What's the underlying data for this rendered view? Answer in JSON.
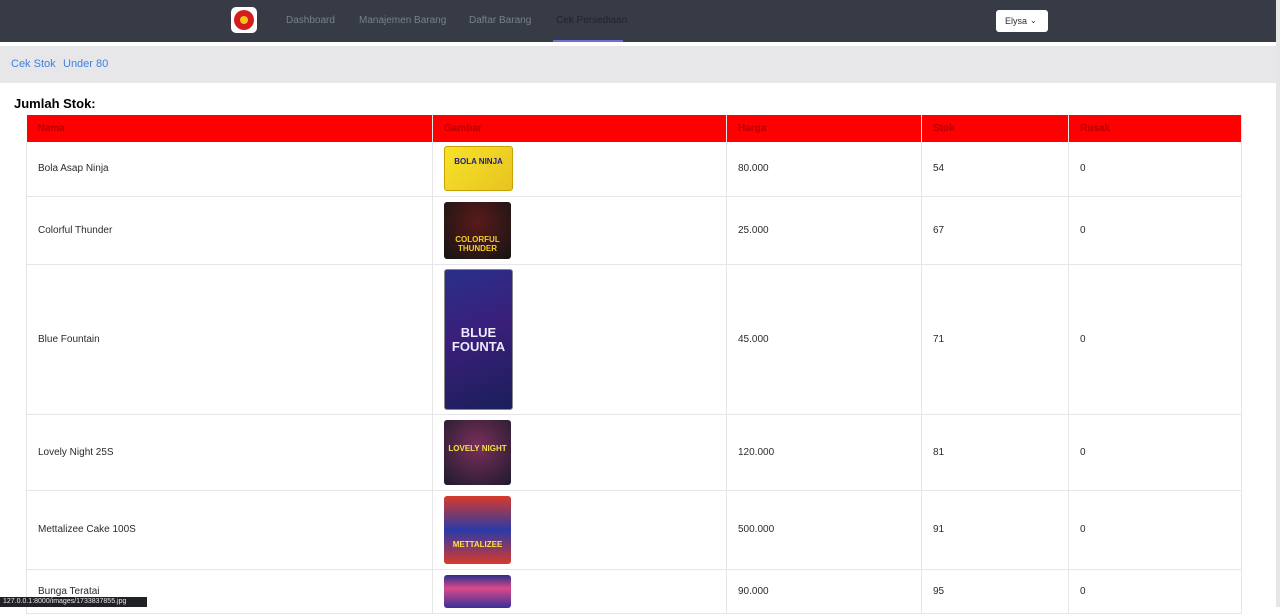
{
  "nav": {
    "logo": "firework-logo",
    "items": [
      {
        "label": "Dashboard"
      },
      {
        "label": "Manajemen Barang"
      },
      {
        "label": "Daftar Barang"
      },
      {
        "label": "Cek Persediaan",
        "active": true
      }
    ],
    "user": {
      "name": "Elysa",
      "icon": "chevron-down-icon"
    }
  },
  "subnav": {
    "items": [
      {
        "label": "Cek Stok"
      },
      {
        "label": "Under 80"
      }
    ]
  },
  "heading": "Jumlah Stok:",
  "table": {
    "headers": [
      "Nama",
      "Gambar",
      "Harga",
      "Stok",
      "Rusak"
    ],
    "rows": [
      {
        "nama": "Bola Asap Ninja",
        "gambar_text": "BOLA NINJA",
        "harga": "80.000",
        "stok": "54",
        "rusak": "0"
      },
      {
        "nama": "Colorful Thunder",
        "gambar_text": "COLORFUL THUNDER",
        "harga": "25.000",
        "stok": "67",
        "rusak": "0"
      },
      {
        "nama": "Blue Fountain",
        "gambar_text": "BLUE FOUNTA",
        "harga": "45.000",
        "stok": "71",
        "rusak": "0"
      },
      {
        "nama": "Lovely Night 25S",
        "gambar_text": "LOVELY NIGHT",
        "harga": "120.000",
        "stok": "81",
        "rusak": "0"
      },
      {
        "nama": "Mettalizee Cake 100S",
        "gambar_text": "METTALIZEE",
        "harga": "500.000",
        "stok": "91",
        "rusak": "0"
      },
      {
        "nama": "Bunga Teratai",
        "gambar_text": "",
        "harga": "90.000",
        "stok": "95",
        "rusak": "0"
      }
    ]
  },
  "status_bar": "127.0.0.1:8000/images/1733837855.jpg",
  "colors": {
    "nav_bg": "#363b45",
    "header_red": "#fe0000",
    "link_blue": "#3d7fe0",
    "accent_underline": "#6b6fd6"
  }
}
